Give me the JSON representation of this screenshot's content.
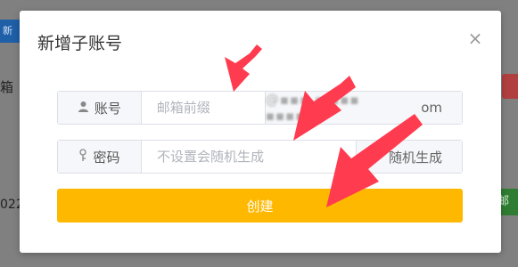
{
  "background": {
    "left_tab_label": "新",
    "left_char": "箱",
    "left_date": "022",
    "right_button_label": "邮箱"
  },
  "modal": {
    "title": "新增子账号",
    "close_symbol": "×"
  },
  "account_row": {
    "label": "账号",
    "icon": "user-icon",
    "placeholder": "邮箱前缀",
    "domain_suffix_visible": "om"
  },
  "password_row": {
    "label": "密码",
    "icon": "key-icon",
    "placeholder": "不设置会随机生成",
    "generate_button": "随机生成"
  },
  "create_button": "创建",
  "colors": {
    "accent": "#ffb800",
    "arrow": "#ff3b4f"
  }
}
